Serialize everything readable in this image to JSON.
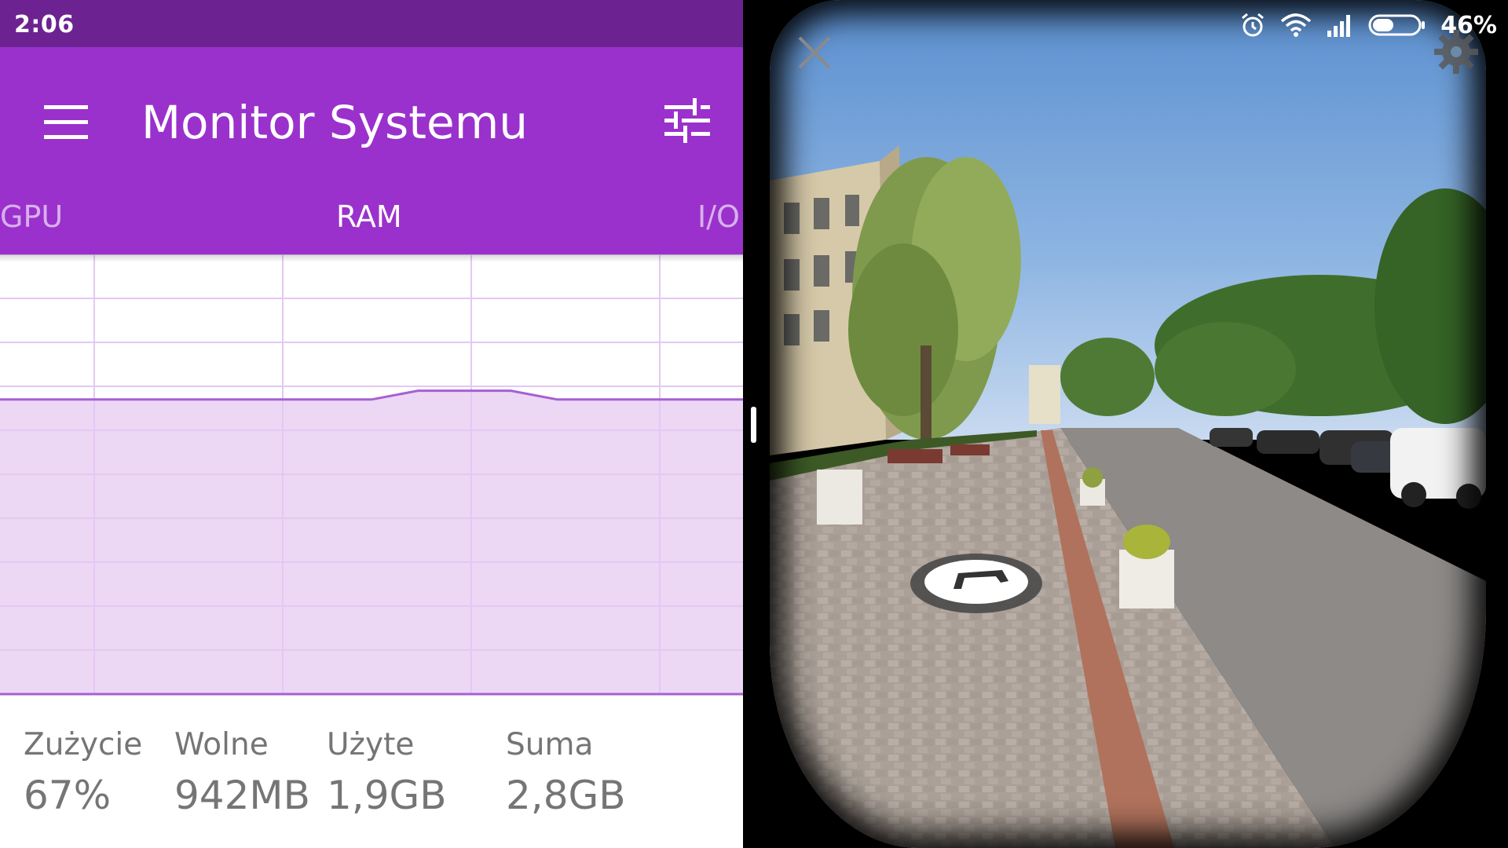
{
  "status_bar": {
    "time": "2:06",
    "battery_percent": "46%",
    "battery_level": 0.46
  },
  "app_bar": {
    "title": "Monitor Systemu",
    "background_color": "#9a31cc",
    "status_color": "#6c2391",
    "menu_icon": "hamburger-menu-icon",
    "tune_icon": "tune-sliders-icon"
  },
  "tabs": [
    {
      "label": "GPU",
      "active": false
    },
    {
      "label": "RAM",
      "active": true
    },
    {
      "label": "I/O",
      "active": false
    }
  ],
  "chart_data": {
    "type": "area",
    "y_min": 0,
    "y_max": 100,
    "x": [
      0,
      1,
      2,
      3,
      4,
      5,
      6,
      7,
      8,
      9,
      10,
      11,
      12,
      13,
      14,
      15,
      16
    ],
    "values": [
      67,
      67,
      67,
      67,
      67,
      67,
      67,
      67,
      67,
      69,
      69,
      69,
      67,
      67,
      67,
      67,
      67
    ],
    "grid": true,
    "line_color": "#a760d0",
    "fill_color": "#ecd7f5",
    "grid_color": "#e4c8f2"
  },
  "stats": [
    {
      "label": "Zużycie",
      "value": "67%"
    },
    {
      "label": "Wolne",
      "value": "942MB"
    },
    {
      "label": "Użyte",
      "value": "1,9GB"
    },
    {
      "label": "Suma",
      "value": "2,8GB"
    }
  ],
  "vr_viewer": {
    "close_icon": "close-icon",
    "settings_icon": "gear-icon",
    "navigation_icon": "navigation-arrow-icon"
  },
  "system_icons": [
    "alarm-icon",
    "wifi-icon",
    "signal-icon",
    "battery-icon"
  ]
}
